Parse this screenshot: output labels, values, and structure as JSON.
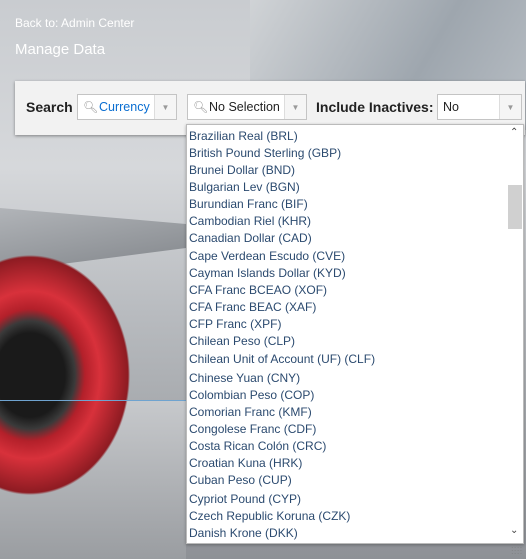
{
  "header": {
    "back_link": "Back to: Admin Center",
    "title": "Manage Data"
  },
  "search_bar": {
    "search_label": "Search",
    "type_value": "Currency",
    "object_value": "No Selection",
    "inactives_label": "Include Inactives:",
    "inactives_value": "No"
  },
  "dropdown": {
    "items": [
      "Brazilian Real (BRL)",
      "British Pound Sterling (GBP)",
      "Brunei Dollar (BND)",
      "Bulgarian Lev (BGN)",
      "Burundian Franc (BIF)",
      "Cambodian Riel (KHR)",
      "Canadian Dollar (CAD)",
      "Cape Verdean Escudo (CVE)",
      "Cayman Islands Dollar (KYD)",
      "CFA Franc BCEAO (XOF)",
      "CFA Franc BEAC (XAF)",
      "CFP Franc (XPF)",
      "Chilean Peso (CLP)",
      "Chilean Unit of Account (UF) (CLF)",
      "Chinese Yuan (CNY)",
      "Colombian Peso (COP)",
      "Comorian Franc (KMF)",
      "Congolese Franc (CDF)",
      "Costa Rican Colón (CRC)",
      "Croatian Kuna (HRK)",
      "Cuban Peso (CUP)",
      "Cypriot Pound (CYP)",
      "Czech Republic Koruna (CZK)",
      "Danish Krone (DKK)"
    ]
  },
  "colors": {
    "selected_text": "#0a6ed1",
    "list_text": "#2b4a6f"
  }
}
